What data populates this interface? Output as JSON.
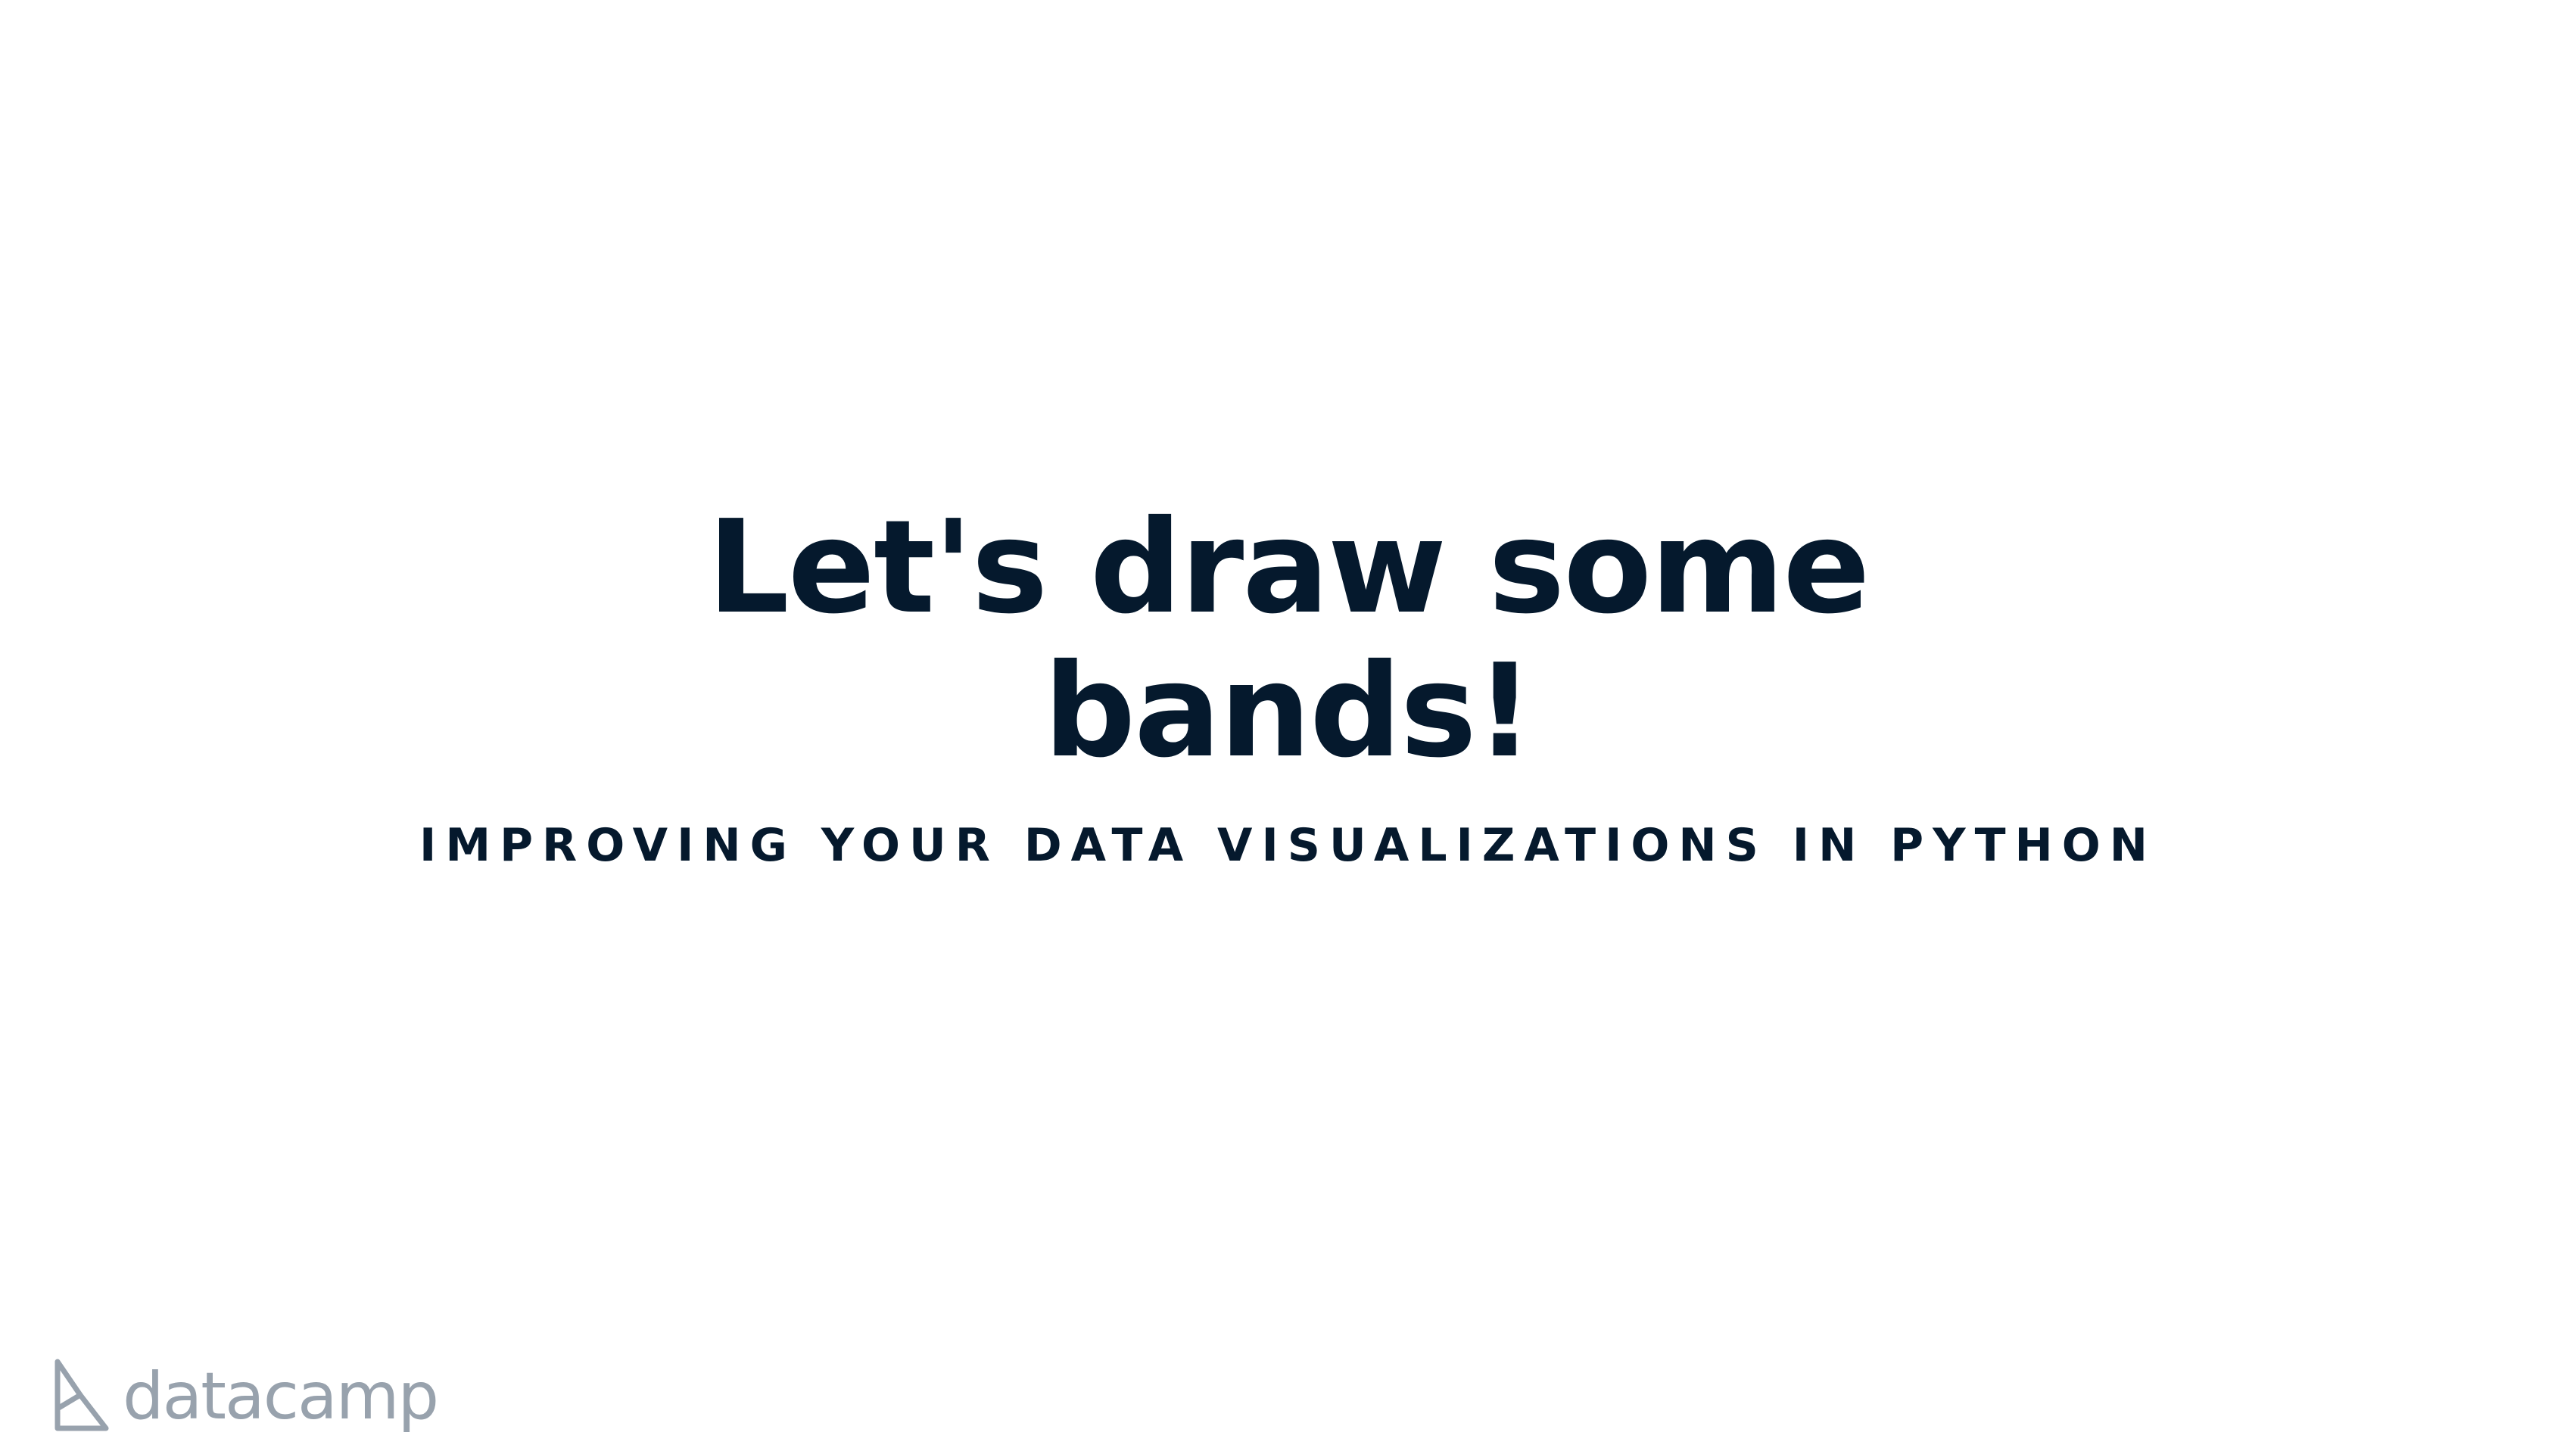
{
  "slide": {
    "title_line1": "Let's draw some",
    "title_line2": "bands!",
    "subtitle": "IMPROVING YOUR DATA VISUALIZATIONS IN PYTHON"
  },
  "branding": {
    "logo_icon": "datacamp-logo-mark-icon",
    "wordmark": "datacamp"
  },
  "colors": {
    "text": "#05192d",
    "logo": "#98a2ad",
    "background": "#ffffff"
  }
}
